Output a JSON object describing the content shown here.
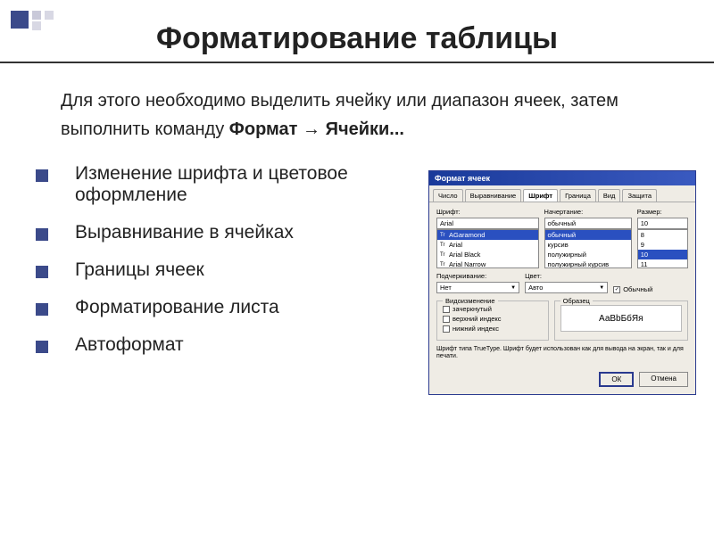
{
  "title": "Форматирование таблицы",
  "intro_part1": "Для этого необходимо выделить ячейку или диапазон ячеек, затем выполнить команду ",
  "intro_bold": "Формат → Ячейки...",
  "bullets": [
    "Изменение шрифта и цветовое оформление",
    "Выравнивание в ячейках",
    "Границы ячеек",
    "Форматирование листа",
    "Автоформат"
  ],
  "dialog": {
    "title": "Формат ячеек",
    "tabs": [
      "Число",
      "Выравнивание",
      "Шрифт",
      "Граница",
      "Вид",
      "Защита"
    ],
    "active_tab": "Шрифт",
    "labels": {
      "font": "Шрифт:",
      "style": "Начертание:",
      "size": "Размер:",
      "underline": "Подчеркивание:",
      "color": "Цвет:"
    },
    "font_value": "Arial",
    "font_list": [
      "AGaramond",
      "Arial",
      "Arial Black",
      "Arial Narrow"
    ],
    "style_value": "обычный",
    "style_list": [
      "обычный",
      "курсив",
      "полужирный",
      "полужирный курсив"
    ],
    "size_value": "10",
    "size_list": [
      "8",
      "9",
      "10",
      "11"
    ],
    "underline_value": "Нет",
    "color_value": "Авто",
    "normal_font_label": "Обычный",
    "effects_legend": "Видоизменение",
    "effects": [
      "зачеркнутый",
      "верхний индекс",
      "нижний индекс"
    ],
    "sample_legend": "Образец",
    "sample_text": "АаВbБбЯя",
    "note": "Шрифт типа TrueType. Шрифт будет использован как для вывода на экран, так и для печати.",
    "ok": "ОК",
    "cancel": "Отмена"
  }
}
